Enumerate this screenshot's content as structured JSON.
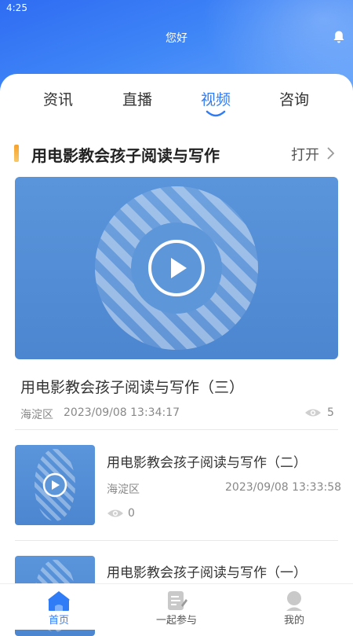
{
  "status_bar": {
    "time": "4:25"
  },
  "header": {
    "title": "您好",
    "bell_icon": "bell-icon"
  },
  "tabs": [
    {
      "label": "资讯",
      "active": false
    },
    {
      "label": "直播",
      "active": false
    },
    {
      "label": "视频",
      "active": true
    },
    {
      "label": "咨询",
      "active": false
    }
  ],
  "section": {
    "title": "用电影教会孩子阅读与写作",
    "open_label": "打开"
  },
  "featured": {
    "title": "用电影教会孩子阅读与写作（三）",
    "district": "海淀区",
    "datetime": "2023/09/08 13:34:17",
    "views": "5"
  },
  "list": [
    {
      "title": "用电影教会孩子阅读与写作（二）",
      "district": "海淀区",
      "datetime": "2023/09/08 13:33:58",
      "views": "0"
    },
    {
      "title": "用电影教会孩子阅读与写作（一）"
    }
  ],
  "bottom_nav": [
    {
      "label": "首页",
      "icon": "home-icon",
      "active": true
    },
    {
      "label": "一起参与",
      "icon": "edit-doc-icon",
      "active": false
    },
    {
      "label": "我的",
      "icon": "user-icon",
      "active": false
    }
  ],
  "colors": {
    "accent": "#2f7cf6",
    "header_gradient_start": "#2f6cf2",
    "section_bar": "#f7a22a"
  }
}
